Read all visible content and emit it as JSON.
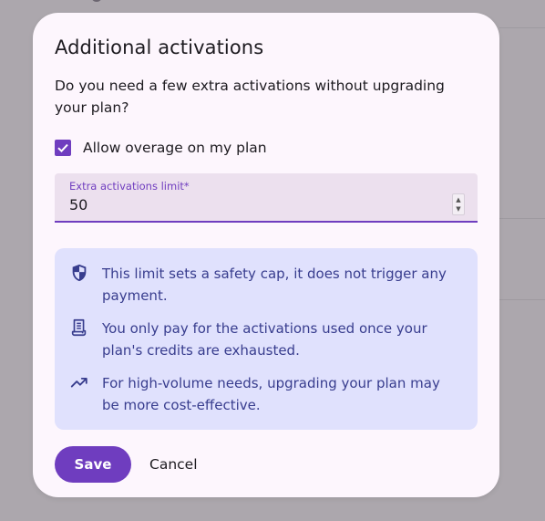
{
  "dialog": {
    "title": "Additional activations",
    "description": "Do you need a few extra activations without upgrading your plan?"
  },
  "overage": {
    "label": "Allow overage on my plan",
    "checked": true
  },
  "limit_field": {
    "label": "Extra activations limit*",
    "value": "50"
  },
  "info": {
    "items": [
      {
        "icon": "shield-icon",
        "text": "This limit sets a safety cap, it does not trigger any payment."
      },
      {
        "icon": "receipt-icon",
        "text": "You only pay for the activations used once your plan's credits are exhausted."
      },
      {
        "icon": "trending-up-icon",
        "text": "For high-volume needs, upgrading your plan may be more cost-effective."
      }
    ]
  },
  "actions": {
    "save_label": "Save",
    "cancel_label": "Cancel"
  },
  "colors": {
    "accent": "#6f3dbf",
    "info_background": "#e0e1fd",
    "info_text": "#383d8e",
    "dialog_background": "#fdf6fd",
    "scrim": "#aca7ad"
  }
}
